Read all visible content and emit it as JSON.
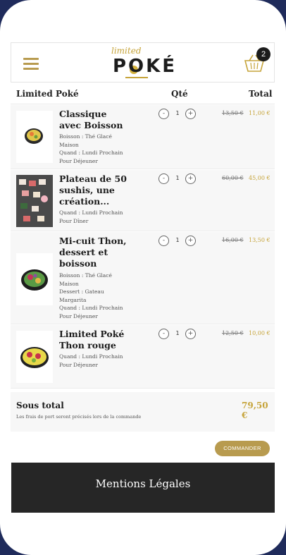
{
  "header": {
    "logo_small": "limited",
    "logo_big": "POKÉ",
    "cart_count": "2"
  },
  "table": {
    "col_name": "Limited Poké",
    "col_qty": "Qté",
    "col_total": "Total"
  },
  "items": [
    {
      "title": "Classique avec Boisson",
      "details": [
        "Boisson : Thé Glacé Maison",
        "Quand : Lundi Prochain Pour Déjeuner"
      ],
      "qty": "1",
      "old_price": "13,50 €",
      "new_price": "11,00 €"
    },
    {
      "title": "Plateau de 50 sushis, une création...",
      "details": [
        "Quand : Lundi Prochain Pour Dîner"
      ],
      "qty": "1",
      "old_price": "60,00 €",
      "new_price": "45,00 €"
    },
    {
      "title": "Mi-cuit Thon, dessert et boisson",
      "details": [
        "Boisson : Thé Glacé Maison",
        "Dessert : Gateau Margarita",
        "Quand : Lundi Prochain Pour Déjeuner"
      ],
      "qty": "1",
      "old_price": "16,00 €",
      "new_price": "13,50 €"
    },
    {
      "title": "Limited Poké Thon rouge",
      "details": [
        "Quand : Lundi Prochain Pour Déjeuner"
      ],
      "qty": "1",
      "old_price": "12,50 €",
      "new_price": "10,00 €"
    }
  ],
  "qty_controls": {
    "minus": "-",
    "plus": "+"
  },
  "summary": {
    "label": "Sous total",
    "note": "Les frais de port seront précisés lors de la commande",
    "value": "79,50 €"
  },
  "actions": {
    "order_label": "COMMANDER"
  },
  "footer": {
    "link": "Mentions Légales"
  },
  "colors": {
    "accent": "#b89b4f",
    "frame": "#1f2b5b",
    "footer_bg": "#262626"
  }
}
